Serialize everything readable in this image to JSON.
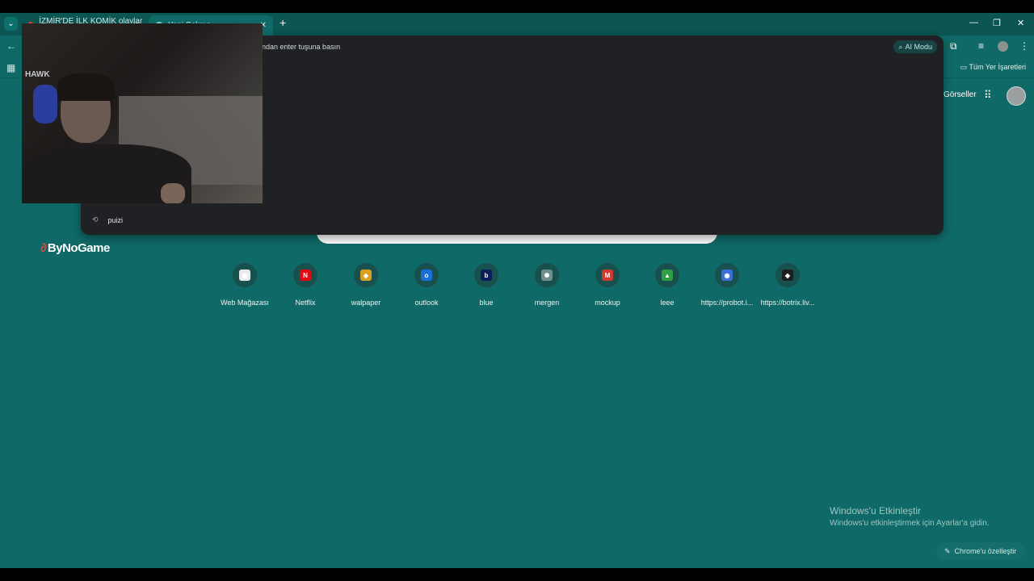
{
  "tabs": [
    {
      "title": "İZMİR'DE İLK KOMİK olaylar SCA..."
    },
    {
      "title": "Yeni Sekme"
    }
  ],
  "toolbar": {
    "ai_mode_label": "AI Modu",
    "all_bookmarks_label": "Tüm Yer İşaretleri"
  },
  "omnibox_dropdown": {
    "hint_text": "ndan enter tuşuna basın",
    "suggestion": "puizi"
  },
  "google_header": {
    "images_link": "Görseller"
  },
  "overlay": {
    "brand": "ByNoGame",
    "webcam_logo": "HAWK"
  },
  "shortcuts": [
    {
      "label": "Web Mağazası",
      "glyph": "▣",
      "color": "#e8eaed"
    },
    {
      "label": "Netflix",
      "glyph": "N",
      "color": "#e50914"
    },
    {
      "label": "walpaper",
      "glyph": "◆",
      "color": "#d9a020"
    },
    {
      "label": "outlook",
      "glyph": "o",
      "color": "#1a6fd6"
    },
    {
      "label": "blue",
      "glyph": "b",
      "color": "#0b1f5c"
    },
    {
      "label": "mergen",
      "glyph": "✺",
      "color": "#6f8d8b"
    },
    {
      "label": "mockup",
      "glyph": "M",
      "color": "#d2382d"
    },
    {
      "label": "leee",
      "glyph": "▲",
      "color": "#2f9e44"
    },
    {
      "label": "https://probot.i...",
      "glyph": "◉",
      "color": "#3a6fd8"
    },
    {
      "label": "https://botrix.liv...",
      "glyph": "◆",
      "color": "#1e1e1e"
    }
  ],
  "windows_activation": {
    "title": "Windows'u Etkinleştir",
    "subtitle": "Windows'u etkinleştirmek için Ayarlar'a gidin."
  },
  "customize_chrome_label": "Chrome'u özelleştir"
}
